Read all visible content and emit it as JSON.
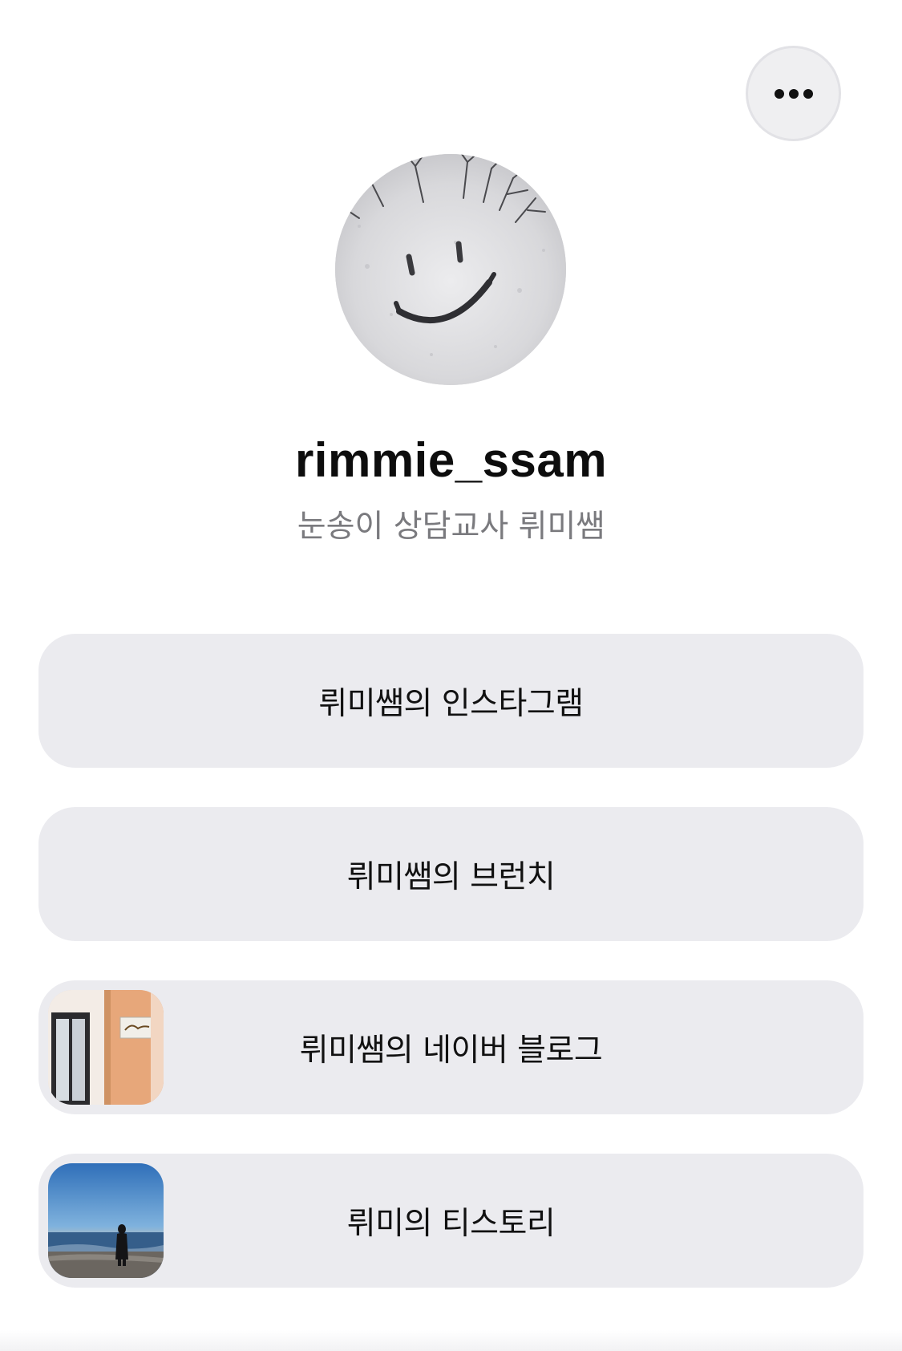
{
  "profile": {
    "username": "rimmie_ssam",
    "bio": "눈송이 상담교사 뤼미쌤",
    "avatar_icon": "snow-smiley-photo"
  },
  "header": {
    "more_icon": "more-horizontal-icon"
  },
  "links": [
    {
      "label": "뤼미쌤의 인스타그램",
      "thumbnail": null
    },
    {
      "label": "뤼미쌤의 브런치",
      "thumbnail": null
    },
    {
      "label": "뤼미쌤의 네이버 블로그",
      "thumbnail": "cafe-storefront-photo"
    },
    {
      "label": "뤼미의 티스토리",
      "thumbnail": "beach-sunset-photo"
    }
  ],
  "colors": {
    "background": "#ffffff",
    "card": "#ebebef",
    "text_primary": "#0d0d0d",
    "text_secondary": "#7a7a7e"
  }
}
